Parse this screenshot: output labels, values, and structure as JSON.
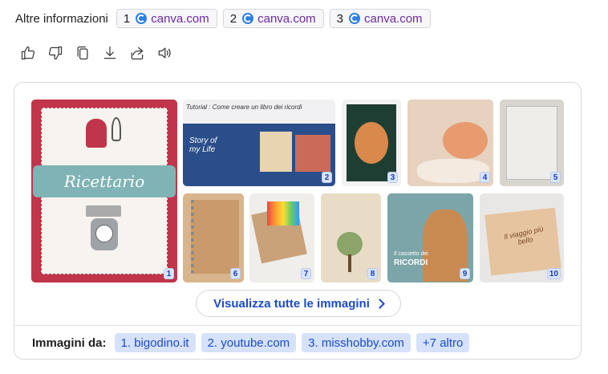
{
  "more_info": {
    "label": "Altre informazioni",
    "sources": [
      {
        "num": "1",
        "domain": "canva.com",
        "icon": "canva-favicon"
      },
      {
        "num": "2",
        "domain": "canva.com",
        "icon": "canva-favicon"
      },
      {
        "num": "3",
        "domain": "canva.com",
        "icon": "canva-favicon"
      }
    ]
  },
  "actions": [
    "thumbs-up-icon",
    "thumbs-down-icon",
    "copy-icon",
    "download-icon",
    "share-icon",
    "speaker-icon"
  ],
  "images": {
    "badges": [
      "1",
      "2",
      "3",
      "4",
      "5",
      "6",
      "7",
      "8",
      "9",
      "10"
    ],
    "captions": {
      "ricettario": "Ricettario",
      "tutorial": "Tutorial : Come creare un libro dei ricordi",
      "story": "Story of my Life",
      "ricordi": "RICORDI",
      "cassetto": "Il cassetto dei",
      "viaggio": "Il viaggio più bello"
    },
    "view_all_label": "Visualizza tutte le immagini"
  },
  "credits": {
    "label": "Immagini da:",
    "chips": [
      "1. bigodino.it",
      "2. youtube.com",
      "3. misshobby.com",
      "+7 altro"
    ]
  },
  "colors": {
    "accent": "#1a4bc9",
    "chip_bg": "#d6e2fb",
    "badge_bg": "#d9e4ff",
    "source_text": "#6a2aa0"
  }
}
